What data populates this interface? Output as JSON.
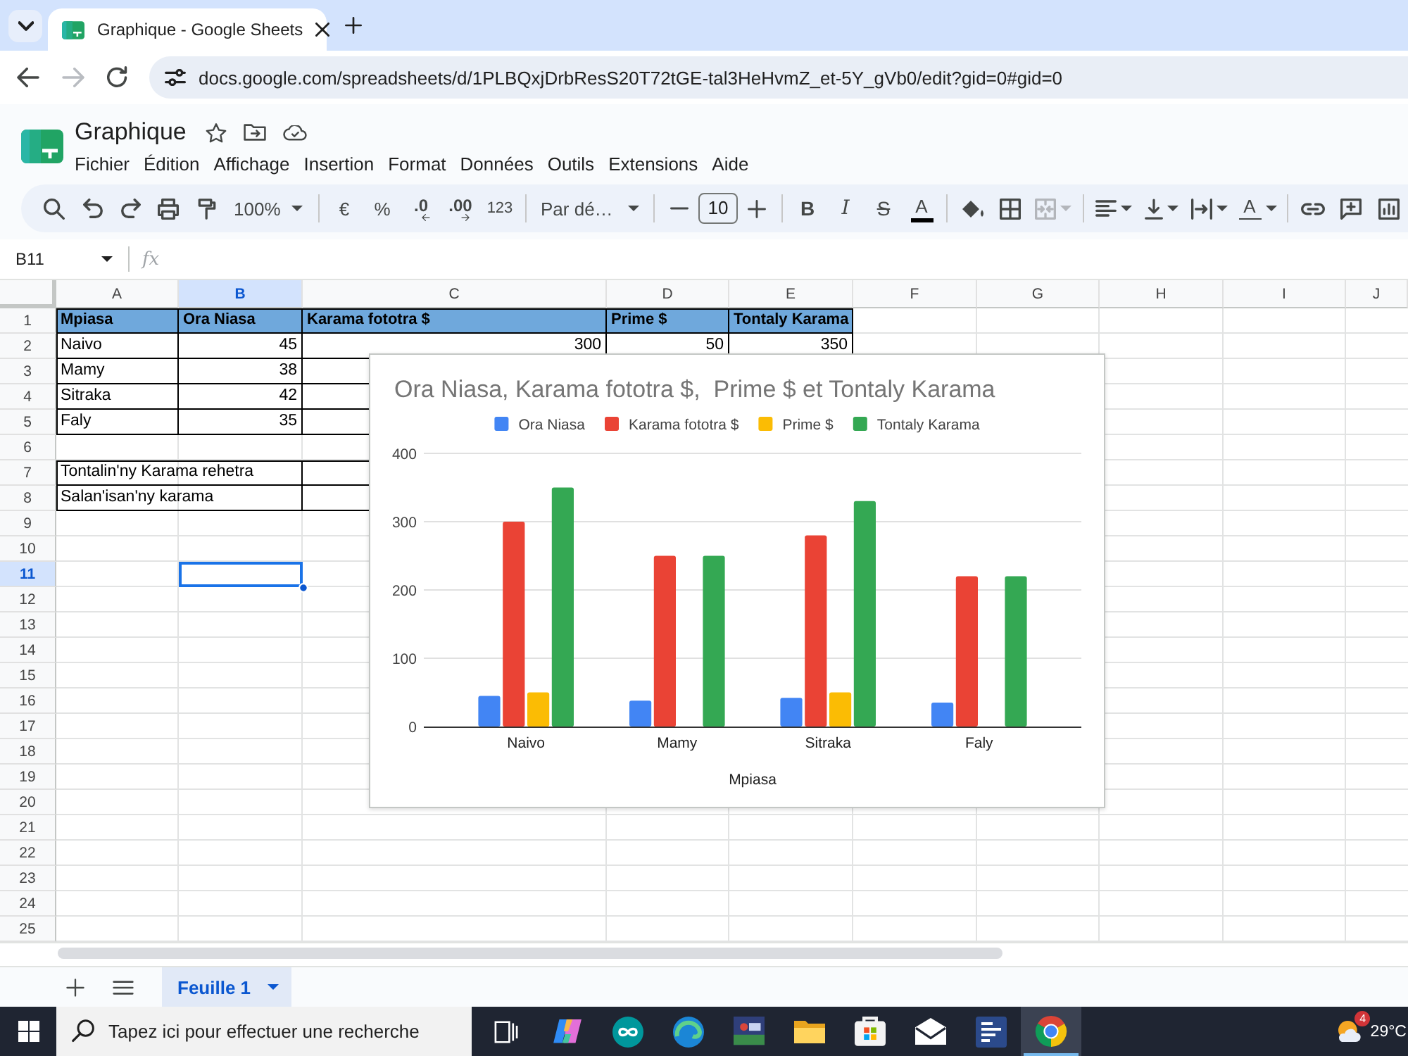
{
  "browser": {
    "tabs": [
      {
        "title": "Graphique - Google Sheets",
        "selected": true
      }
    ],
    "forward_disabled": true,
    "url": "docs.google.com/spreadsheets/d/1PLBQxjDrbResS20T72tGE-tal3HeHvmZ_et-5Y_gVb0/edit?gid=0#gid=0"
  },
  "document": {
    "title": "Graphique",
    "menu": [
      "Fichier",
      "Édition",
      "Affichage",
      "Insertion",
      "Format",
      "Données",
      "Outils",
      "Extensions",
      "Aide"
    ]
  },
  "toolbar": {
    "zoom": "100%",
    "currency": "€",
    "percent": "%",
    "decrease_decimals": ".0",
    "increase_decimals": ".00",
    "number_format": "123",
    "font": "Par dé…",
    "font_size": "10",
    "bold": "B",
    "italic": "I",
    "strikethrough": "S",
    "text_color": "A",
    "merge_disabled": true,
    "text_rotation": "A"
  },
  "formula_bar": {
    "cell_ref": "B11",
    "function_symbol": "fx"
  },
  "table": {
    "columns": [
      {
        "label": "A",
        "selected": false
      },
      {
        "label": "B",
        "selected": true
      },
      {
        "label": "C",
        "selected": false
      },
      {
        "label": "D",
        "selected": false
      },
      {
        "label": "E",
        "selected": false
      },
      {
        "label": "F",
        "selected": false
      },
      {
        "label": "G",
        "selected": false
      },
      {
        "label": "H",
        "selected": false
      },
      {
        "label": "I",
        "selected": false
      },
      {
        "label": "J",
        "selected": false
      }
    ],
    "rows": [
      {
        "label": "1",
        "selected": false,
        "header": true,
        "bordered": true,
        "cells": [
          {
            "text": "Mpiasa",
            "kind": "text"
          },
          {
            "text": "Ora Niasa",
            "kind": "text"
          },
          {
            "text": "Karama fototra $",
            "kind": "text"
          },
          {
            "text": "Prime $",
            "kind": "text"
          },
          {
            "text": "Tontaly Karama",
            "kind": "text"
          }
        ]
      },
      {
        "label": "2",
        "selected": false,
        "header": false,
        "bordered": true,
        "cells": [
          {
            "text": "Naivo",
            "kind": "text"
          },
          {
            "text": "45",
            "kind": "number"
          },
          {
            "text": "300",
            "kind": "number"
          },
          {
            "text": "50",
            "kind": "number"
          },
          {
            "text": "350",
            "kind": "number"
          }
        ]
      },
      {
        "label": "3",
        "selected": false,
        "header": false,
        "bordered": true,
        "cells": [
          {
            "text": "Mamy",
            "kind": "text"
          },
          {
            "text": "38",
            "kind": "number"
          }
        ]
      },
      {
        "label": "4",
        "selected": false,
        "header": false,
        "bordered": true,
        "cells": [
          {
            "text": "Sitraka",
            "kind": "text"
          },
          {
            "text": "42",
            "kind": "number"
          }
        ]
      },
      {
        "label": "5",
        "selected": false,
        "header": false,
        "bordered": true,
        "cells": [
          {
            "text": "Faly",
            "kind": "text"
          },
          {
            "text": "35",
            "kind": "number"
          }
        ]
      },
      {
        "label": "6",
        "selected": false,
        "header": false,
        "bordered": false
      },
      {
        "label": "7",
        "selected": false,
        "header": false,
        "bordered": true,
        "cells": [
          {
            "text": "Tontalin'ny Karama rehetra",
            "kind": "text",
            "merged": true
          }
        ]
      },
      {
        "label": "8",
        "selected": false,
        "header": false,
        "bordered": true,
        "cells": [
          {
            "text": "Salan'isan'ny karama",
            "kind": "text",
            "merged": true
          }
        ]
      },
      {
        "label": "9",
        "selected": false,
        "header": false,
        "bordered": false
      },
      {
        "label": "10",
        "selected": false,
        "header": false,
        "bordered": false
      },
      {
        "label": "11",
        "selected": true,
        "header": false,
        "bordered": false
      },
      {
        "label": "12",
        "selected": false,
        "header": false,
        "bordered": false
      },
      {
        "label": "13",
        "selected": false,
        "header": false,
        "bordered": false
      },
      {
        "label": "14",
        "selected": false,
        "header": false,
        "bordered": false
      },
      {
        "label": "15",
        "selected": false,
        "header": false,
        "bordered": false
      },
      {
        "label": "16",
        "selected": false,
        "header": false,
        "bordered": false
      },
      {
        "label": "17",
        "selected": false,
        "header": false,
        "bordered": false
      },
      {
        "label": "18",
        "selected": false,
        "header": false,
        "bordered": false
      },
      {
        "label": "19",
        "selected": false,
        "header": false,
        "bordered": false
      },
      {
        "label": "20",
        "selected": false,
        "header": false,
        "bordered": false
      },
      {
        "label": "21",
        "selected": false,
        "header": false,
        "bordered": false
      },
      {
        "label": "22",
        "selected": false,
        "header": false,
        "bordered": false
      },
      {
        "label": "23",
        "selected": false,
        "header": false,
        "bordered": false
      },
      {
        "label": "24",
        "selected": false,
        "header": false,
        "bordered": false
      },
      {
        "label": "25",
        "selected": false,
        "header": false,
        "bordered": false
      }
    ]
  },
  "chart": {
    "chart_data": {
      "type": "bar",
      "title": "Ora Niasa, Karama fototra $,  Prime $ et Tontaly Karama",
      "xlabel": "Mpiasa",
      "legend": "top",
      "grid": true,
      "categories": [
        "Naivo",
        "Mamy",
        "Sitraka",
        "Faly"
      ],
      "series": [
        {
          "name": "Ora Niasa",
          "color": "#4285f4",
          "values": [
            45,
            38,
            42,
            35
          ]
        },
        {
          "name": "Karama fototra $",
          "color": "#ea4335",
          "values": [
            300,
            250,
            280,
            220
          ]
        },
        {
          "name": "Prime $",
          "color": "#fbbc04",
          "values": [
            50,
            null,
            50,
            null
          ]
        },
        {
          "name": "Tontaly Karama",
          "color": "#34a853",
          "values": [
            350,
            250,
            330,
            220
          ]
        }
      ],
      "ylim": [
        0,
        400
      ],
      "yticks": [
        0,
        100,
        200,
        300,
        400
      ]
    }
  },
  "sheet_tabs": [
    {
      "label": "Feuille 1",
      "selected": true
    }
  ],
  "taskbar": {
    "search": {
      "placeholder": "Tapez ici pour effectuer une recherche"
    },
    "apps": [
      {
        "selected": false
      },
      {
        "selected": false
      },
      {
        "selected": false
      },
      {
        "selected": false
      },
      {
        "selected": false
      },
      {
        "selected": false
      },
      {
        "selected": false
      },
      {
        "selected": false
      },
      {
        "selected": true
      }
    ],
    "weather": {
      "temperature": "29°C",
      "badge": "4"
    }
  }
}
